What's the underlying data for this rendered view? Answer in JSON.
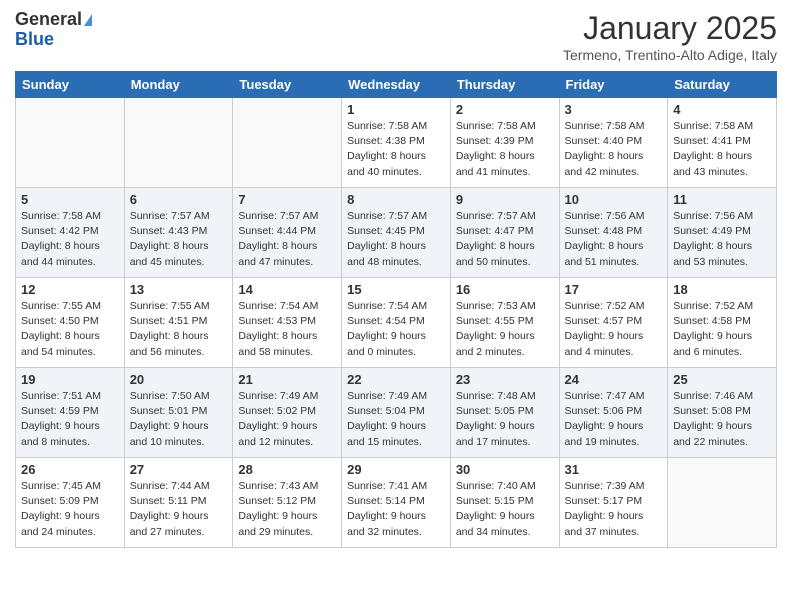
{
  "header": {
    "logo_general": "General",
    "logo_blue": "Blue",
    "month": "January 2025",
    "location": "Termeno, Trentino-Alto Adige, Italy"
  },
  "weekdays": [
    "Sunday",
    "Monday",
    "Tuesday",
    "Wednesday",
    "Thursday",
    "Friday",
    "Saturday"
  ],
  "weeks": [
    [
      {
        "day": "",
        "info": ""
      },
      {
        "day": "",
        "info": ""
      },
      {
        "day": "",
        "info": ""
      },
      {
        "day": "1",
        "info": "Sunrise: 7:58 AM\nSunset: 4:38 PM\nDaylight: 8 hours\nand 40 minutes."
      },
      {
        "day": "2",
        "info": "Sunrise: 7:58 AM\nSunset: 4:39 PM\nDaylight: 8 hours\nand 41 minutes."
      },
      {
        "day": "3",
        "info": "Sunrise: 7:58 AM\nSunset: 4:40 PM\nDaylight: 8 hours\nand 42 minutes."
      },
      {
        "day": "4",
        "info": "Sunrise: 7:58 AM\nSunset: 4:41 PM\nDaylight: 8 hours\nand 43 minutes."
      }
    ],
    [
      {
        "day": "5",
        "info": "Sunrise: 7:58 AM\nSunset: 4:42 PM\nDaylight: 8 hours\nand 44 minutes."
      },
      {
        "day": "6",
        "info": "Sunrise: 7:57 AM\nSunset: 4:43 PM\nDaylight: 8 hours\nand 45 minutes."
      },
      {
        "day": "7",
        "info": "Sunrise: 7:57 AM\nSunset: 4:44 PM\nDaylight: 8 hours\nand 47 minutes."
      },
      {
        "day": "8",
        "info": "Sunrise: 7:57 AM\nSunset: 4:45 PM\nDaylight: 8 hours\nand 48 minutes."
      },
      {
        "day": "9",
        "info": "Sunrise: 7:57 AM\nSunset: 4:47 PM\nDaylight: 8 hours\nand 50 minutes."
      },
      {
        "day": "10",
        "info": "Sunrise: 7:56 AM\nSunset: 4:48 PM\nDaylight: 8 hours\nand 51 minutes."
      },
      {
        "day": "11",
        "info": "Sunrise: 7:56 AM\nSunset: 4:49 PM\nDaylight: 8 hours\nand 53 minutes."
      }
    ],
    [
      {
        "day": "12",
        "info": "Sunrise: 7:55 AM\nSunset: 4:50 PM\nDaylight: 8 hours\nand 54 minutes."
      },
      {
        "day": "13",
        "info": "Sunrise: 7:55 AM\nSunset: 4:51 PM\nDaylight: 8 hours\nand 56 minutes."
      },
      {
        "day": "14",
        "info": "Sunrise: 7:54 AM\nSunset: 4:53 PM\nDaylight: 8 hours\nand 58 minutes."
      },
      {
        "day": "15",
        "info": "Sunrise: 7:54 AM\nSunset: 4:54 PM\nDaylight: 9 hours\nand 0 minutes."
      },
      {
        "day": "16",
        "info": "Sunrise: 7:53 AM\nSunset: 4:55 PM\nDaylight: 9 hours\nand 2 minutes."
      },
      {
        "day": "17",
        "info": "Sunrise: 7:52 AM\nSunset: 4:57 PM\nDaylight: 9 hours\nand 4 minutes."
      },
      {
        "day": "18",
        "info": "Sunrise: 7:52 AM\nSunset: 4:58 PM\nDaylight: 9 hours\nand 6 minutes."
      }
    ],
    [
      {
        "day": "19",
        "info": "Sunrise: 7:51 AM\nSunset: 4:59 PM\nDaylight: 9 hours\nand 8 minutes."
      },
      {
        "day": "20",
        "info": "Sunrise: 7:50 AM\nSunset: 5:01 PM\nDaylight: 9 hours\nand 10 minutes."
      },
      {
        "day": "21",
        "info": "Sunrise: 7:49 AM\nSunset: 5:02 PM\nDaylight: 9 hours\nand 12 minutes."
      },
      {
        "day": "22",
        "info": "Sunrise: 7:49 AM\nSunset: 5:04 PM\nDaylight: 9 hours\nand 15 minutes."
      },
      {
        "day": "23",
        "info": "Sunrise: 7:48 AM\nSunset: 5:05 PM\nDaylight: 9 hours\nand 17 minutes."
      },
      {
        "day": "24",
        "info": "Sunrise: 7:47 AM\nSunset: 5:06 PM\nDaylight: 9 hours\nand 19 minutes."
      },
      {
        "day": "25",
        "info": "Sunrise: 7:46 AM\nSunset: 5:08 PM\nDaylight: 9 hours\nand 22 minutes."
      }
    ],
    [
      {
        "day": "26",
        "info": "Sunrise: 7:45 AM\nSunset: 5:09 PM\nDaylight: 9 hours\nand 24 minutes."
      },
      {
        "day": "27",
        "info": "Sunrise: 7:44 AM\nSunset: 5:11 PM\nDaylight: 9 hours\nand 27 minutes."
      },
      {
        "day": "28",
        "info": "Sunrise: 7:43 AM\nSunset: 5:12 PM\nDaylight: 9 hours\nand 29 minutes."
      },
      {
        "day": "29",
        "info": "Sunrise: 7:41 AM\nSunset: 5:14 PM\nDaylight: 9 hours\nand 32 minutes."
      },
      {
        "day": "30",
        "info": "Sunrise: 7:40 AM\nSunset: 5:15 PM\nDaylight: 9 hours\nand 34 minutes."
      },
      {
        "day": "31",
        "info": "Sunrise: 7:39 AM\nSunset: 5:17 PM\nDaylight: 9 hours\nand 37 minutes."
      },
      {
        "day": "",
        "info": ""
      }
    ]
  ]
}
